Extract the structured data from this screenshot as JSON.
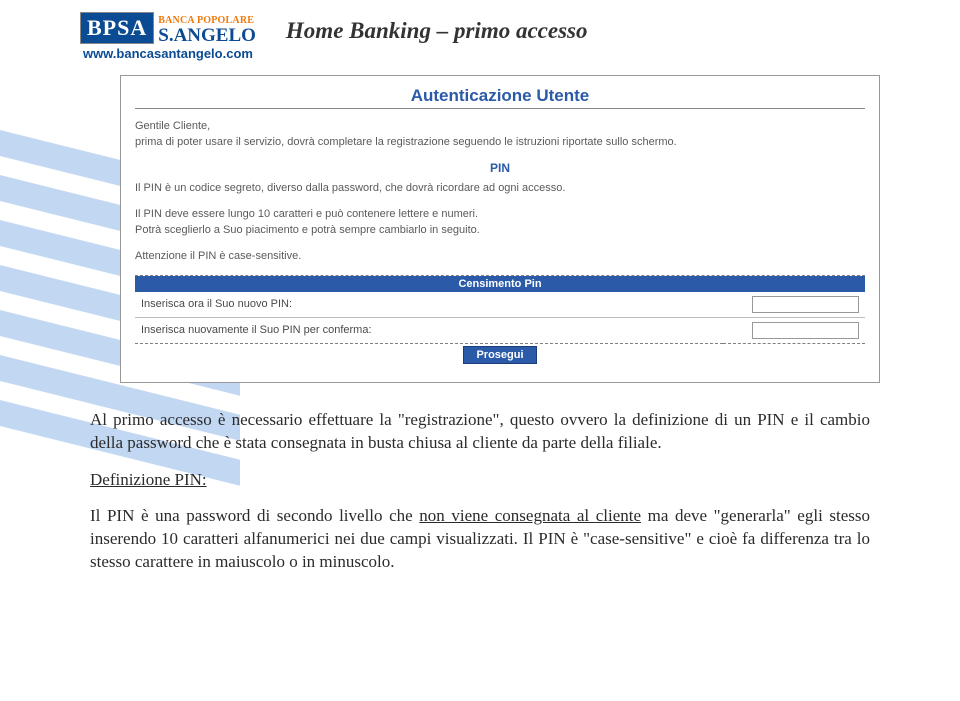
{
  "header": {
    "badge": "BPSA",
    "bank_top": "BANCA POPOLARE",
    "bank_name": "S.ANGELO",
    "url": "www.bancasantangelo.com",
    "page_title": "Home Banking – primo accesso"
  },
  "panel": {
    "title": "Autenticazione Utente",
    "greeting": "Gentile Cliente,",
    "intro": "prima di poter usare il servizio, dovrà completare la registrazione seguendo le istruzioni riportate sullo schermo.",
    "pin_heading": "PIN",
    "pin_desc": "Il PIN è un codice segreto, diverso dalla password, che dovrà ricordare ad ogni accesso.",
    "pin_rule1": "Il PIN deve essere lungo 10 caratteri e può contenere lettere e numeri.",
    "pin_rule2": "Potrà sceglierlo a Suo piacimento e potrà sempre cambiarlo in seguito.",
    "pin_warn": "Attenzione il PIN è case-sensitive.",
    "cens_bar": "Censimento Pin",
    "row1_label": "Inserisca ora il Suo nuovo PIN:",
    "row2_label": "Inserisca nuovamente il Suo PIN per conferma:",
    "proceed": "Prosegui"
  },
  "body": {
    "p1_a": "Al primo accesso è necessario effettuare la \"registrazione\", questo ovvero la definizione di un PIN e il cambio della password che è stata consegnata in busta chiusa al cliente da parte della filiale.",
    "def_label": "Definizione PIN:",
    "p2_a": "Il PIN è una password di secondo livello che ",
    "p2_u": "non viene consegnata al cliente",
    "p2_b": " ma deve \"generarla\" egli stesso inserendo 10 caratteri alfanumerici nei due campi visualizzati. Il PIN è \"case-sensitive\" e cioè fa differenza tra lo stesso carattere in maiuscolo o in minuscolo."
  }
}
